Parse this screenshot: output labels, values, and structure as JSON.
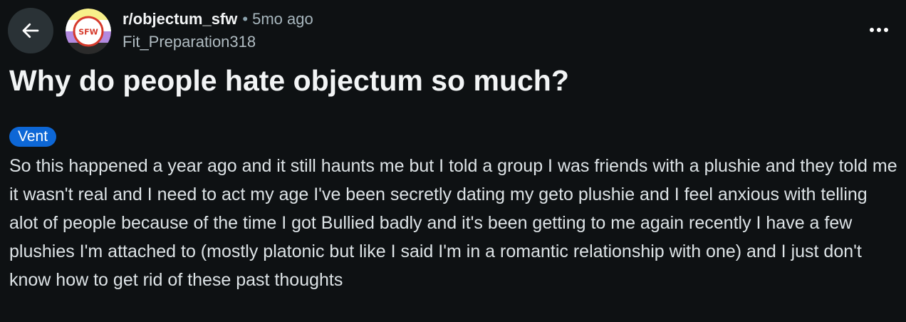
{
  "header": {
    "subreddit": "r/objectum_sfw",
    "separator": "•",
    "time_ago": "5mo ago",
    "author": "Fit_Preparation318",
    "avatar_text": "SFW"
  },
  "post": {
    "title": "Why do people hate objectum so much?",
    "flair": "Vent",
    "body": "So this happened a year ago and it still haunts me but I told a group I was friends with a plushie and they told me it wasn't real and I need to act my age I've been secretly dating my geto plushie and I feel anxious with telling alot of people because of the time I got Bullied badly and it's been getting to me again recently I have a few plushies I'm attached to (mostly platonic but like I said I'm in a romantic relationship with one) and I just don't know how to get rid of these past thoughts"
  },
  "icons": {
    "back": "arrow-left-icon",
    "more": "more-horizontal-icon"
  },
  "colors": {
    "background": "#0e1113",
    "flair": "#0d67d6",
    "back_button": "#2a3236"
  }
}
